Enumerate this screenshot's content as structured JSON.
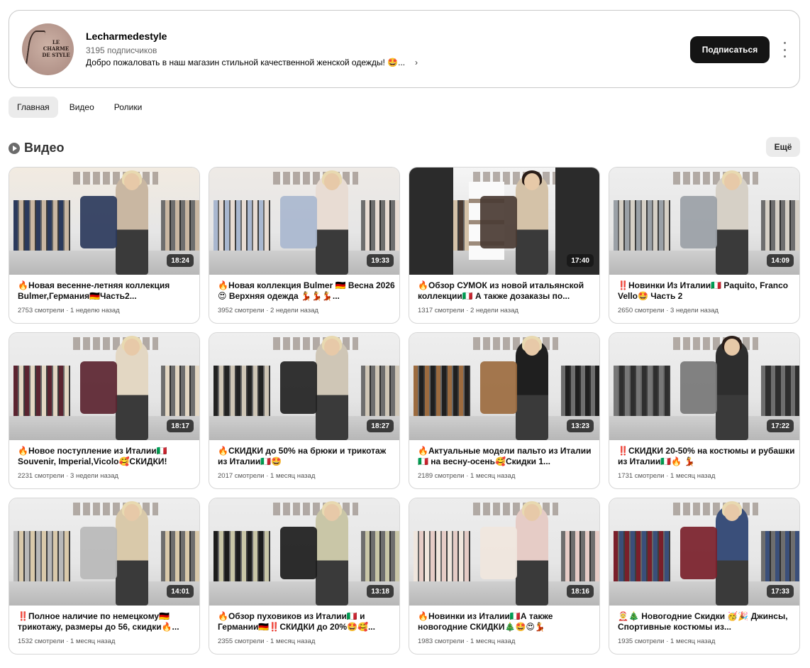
{
  "channel": {
    "logo_text": "LE CHARME DE STYLE",
    "name": "Lecharmedestyle",
    "subscribers": "3195 подписчиков",
    "description": "Добро пожаловать в наш магазин стильной качественной женской одежды! 🤩...",
    "subscribe_label": "Подписаться",
    "more_icon": "vertical-dots-icon"
  },
  "tabs": [
    {
      "label": "Главная",
      "active": true
    },
    {
      "label": "Видео",
      "active": false
    },
    {
      "label": "Ролики",
      "active": false
    }
  ],
  "section": {
    "icon": "video-play-icon",
    "title": "Видео",
    "more_label": "Ещё"
  },
  "videos": [
    {
      "title": "🔥Новая весенне-летняя коллекция Bulmer,Германия🇩🇪Часть2...",
      "views": "2753 смотрели",
      "age": "1 неделю назад",
      "duration": "18:24"
    },
    {
      "title": "🔥Новая коллекция Bulmer 🇩🇪 Весна 2026 😍 Верхняя одежда 💃💃💃...",
      "views": "3952 смотрели",
      "age": "2 недели назад",
      "duration": "19:33"
    },
    {
      "title": "🔥Обзор СУМОК из новой итальянской коллекции🇮🇹 А также дозаказы по...",
      "views": "1317 смотрели",
      "age": "2 недели назад",
      "duration": "17:40"
    },
    {
      "title": "‼️Новинки Из Италии🇮🇹 Paquito, Franco Vello🤩 Часть 2",
      "views": "2650 смотрели",
      "age": "3 недели назад",
      "duration": "14:09"
    },
    {
      "title": "🔥Новое поступление из Италии🇮🇹 Souvenir, Imperial,Vicolo🥰СКИДКИ!",
      "views": "2231 смотрели",
      "age": "3 недели назад",
      "duration": "18:17"
    },
    {
      "title": "🔥СКИДКИ до 50% на брюки и трикотаж из Италии🇮🇹🤩",
      "views": "2017 смотрели",
      "age": "1 месяц назад",
      "duration": "18:27"
    },
    {
      "title": "🔥Актуальные модели пальто из Италии🇮🇹 на весну-осень🥰Скидки 1...",
      "views": "2189 смотрели",
      "age": "1 месяц назад",
      "duration": "13:23"
    },
    {
      "title": "‼️СКИДКИ 20-50% на костюмы и рубашки из Италии🇮🇹🔥 💃",
      "views": "1731 смотрели",
      "age": "1 месяц назад",
      "duration": "17:22"
    },
    {
      "title": "‼️Полное наличие по немецкому🇩🇪 трикотажу, размеры до 56, скидки🔥...",
      "views": "1532 смотрели",
      "age": "1 месяц назад",
      "duration": "14:01"
    },
    {
      "title": "🔥Обзор пуховиков из Италии🇮🇹 и Германии🇩🇪‼️СКИДКИ до 20%🤩🥰...",
      "views": "2355 смотрели",
      "age": "1 месяц назад",
      "duration": "13:18"
    },
    {
      "title": "🔥Новинки из Италии🇮🇹А также новогодние СКИДКИ🎄🤩😍💃",
      "views": "1983 смотрели",
      "age": "1 месяц назад",
      "duration": "18:16"
    },
    {
      "title": "🤶🎄 Новогодние Скидки 🥳🎉 Джинсы, Спортивные костюмы из...",
      "views": "1935 смотрели",
      "age": "1 месяц назад",
      "duration": "17:33"
    }
  ]
}
